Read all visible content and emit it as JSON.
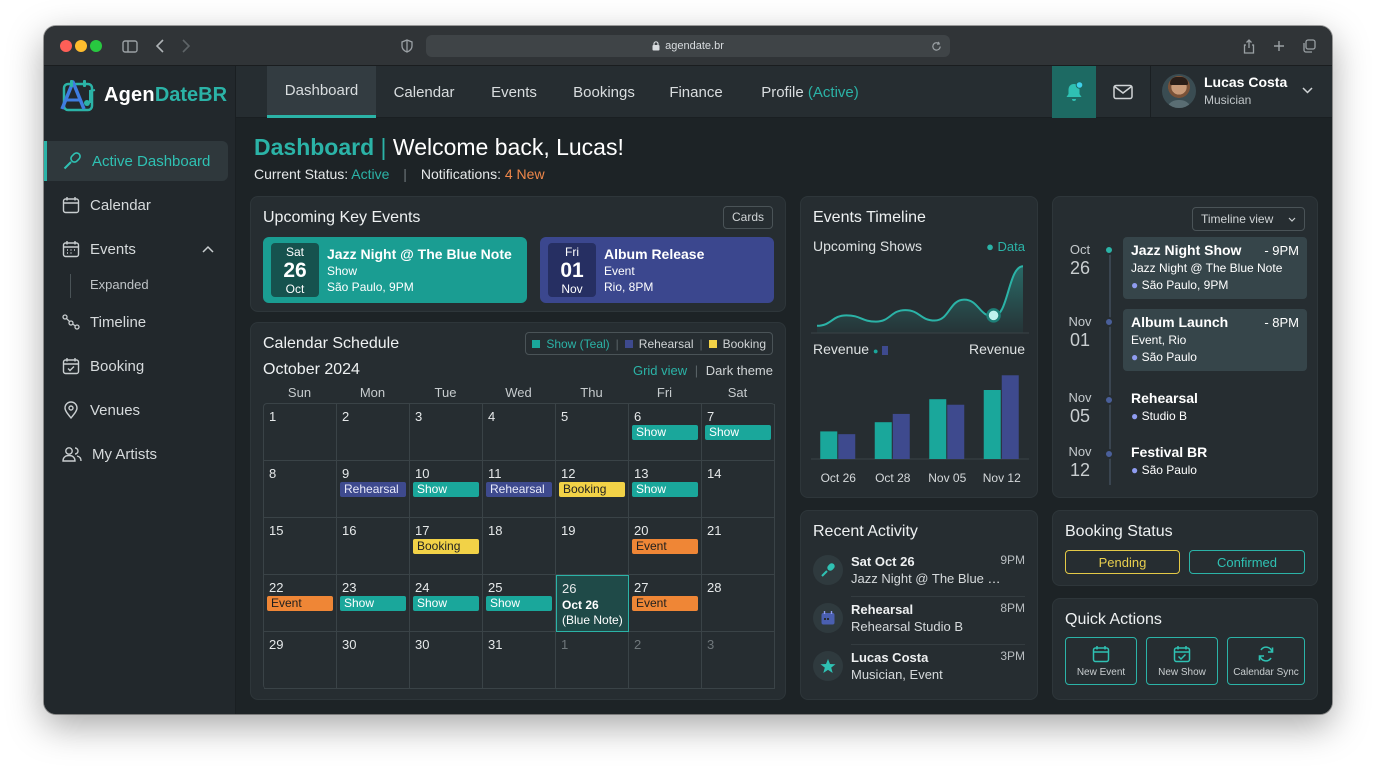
{
  "browser": {
    "url": "agendate.br"
  },
  "logo": {
    "part1": "Agen",
    "part2": "DateBR"
  },
  "sidebar": {
    "items": [
      {
        "label": "Active Dashboard",
        "icon": "microphone-icon"
      },
      {
        "label": "Calendar",
        "icon": "calendar-icon"
      },
      {
        "label": "Events",
        "icon": "calendar-grid-icon"
      },
      {
        "label": "Expanded"
      },
      {
        "label": "Timeline",
        "icon": "timeline-icon"
      },
      {
        "label": "Booking",
        "icon": "booking-icon"
      },
      {
        "label": "Venues",
        "icon": "location-pin-icon"
      },
      {
        "label": "My Artists",
        "icon": "users-icon"
      }
    ]
  },
  "nav": {
    "tabs": [
      "Dashboard",
      "Calendar",
      "Events",
      "Bookings",
      "Finance",
      "Profile"
    ],
    "profile_suffix": "(Active)"
  },
  "user": {
    "name": "Lucas Costa",
    "role": "Musician"
  },
  "header": {
    "title": "Dashboard",
    "sep": "|",
    "welcome": "Welcome back, Lucas!",
    "status_label": "Current Status:",
    "status_value": "Active",
    "notif_label": "Notifications:",
    "notif_value": "4 New"
  },
  "upcoming": {
    "title": "Upcoming Key Events",
    "toggle": "Cards",
    "events": [
      {
        "dow": "Sat",
        "day": "26",
        "mon": "Oct",
        "name": "Jazz Night @ The Blue Note",
        "type": "Show",
        "where": "São Paulo, 9PM"
      },
      {
        "dow": "Fri",
        "day": "01",
        "mon": "Nov",
        "name": "Album Release",
        "type": "Event",
        "where": "Rio, 8PM"
      }
    ]
  },
  "calendar": {
    "title": "Calendar Schedule",
    "month": "October 2024",
    "legend": [
      "Show (Teal)",
      "Rehearsal",
      "Booking"
    ],
    "grid_view": "Grid view",
    "dark_theme": "Dark theme",
    "days": [
      "Sun",
      "Mon",
      "Tue",
      "Wed",
      "Thu",
      "Fri",
      "Sat"
    ],
    "cells": [
      {
        "n": "1"
      },
      {
        "n": "2"
      },
      {
        "n": "3"
      },
      {
        "n": "4"
      },
      {
        "n": "5"
      },
      {
        "n": "6",
        "tag": "Show",
        "kind": "show"
      },
      {
        "n": "7",
        "tag": "Show",
        "kind": "show"
      },
      {
        "n": "8"
      },
      {
        "n": "9",
        "tag": "Rehearsal",
        "kind": "reh"
      },
      {
        "n": "10",
        "tag": "Show",
        "kind": "show"
      },
      {
        "n": "11",
        "tag": "Rehearsal",
        "kind": "reh"
      },
      {
        "n": "12",
        "tag": "Booking",
        "kind": "book"
      },
      {
        "n": "13",
        "tag": "Show",
        "kind": "show"
      },
      {
        "n": "14"
      },
      {
        "n": "15"
      },
      {
        "n": "16"
      },
      {
        "n": "17",
        "tag": "Booking",
        "kind": "book"
      },
      {
        "n": "18"
      },
      {
        "n": "19"
      },
      {
        "n": "20",
        "tag": "Event",
        "kind": "event"
      },
      {
        "n": "21"
      },
      {
        "n": "22",
        "tag": "Event",
        "kind": "event"
      },
      {
        "n": "23",
        "tag": "Show",
        "kind": "show"
      },
      {
        "n": "24",
        "tag": "Show",
        "kind": "show"
      },
      {
        "n": "25",
        "tag": "Show",
        "kind": "show"
      },
      {
        "n": "26",
        "highlight": "Oct 26",
        "note": "(Blue Note)"
      },
      {
        "n": "27",
        "tag": "Event",
        "kind": "event"
      },
      {
        "n": "28"
      },
      {
        "n": "29"
      },
      {
        "n": "30"
      },
      {
        "n": "30"
      },
      {
        "n": "31"
      },
      {
        "n": "1",
        "dim": true
      },
      {
        "n": "2",
        "dim": true
      },
      {
        "n": "3",
        "dim": true
      }
    ]
  },
  "timeline": {
    "title": "Events Timeline",
    "line_label": "Upcoming Shows",
    "data_label": "Data",
    "rev_label_left": "Revenue",
    "rev_label_right": "Revenue"
  },
  "chart_data": [
    {
      "type": "area",
      "values": [
        5,
        15,
        9,
        20,
        10,
        30,
        14,
        62
      ],
      "highlight_index": 6
    },
    {
      "type": "bar",
      "categories": [
        "Oct 26",
        "Oct 28",
        "Nov 05",
        "Nov 12"
      ],
      "series": [
        {
          "values": [
            30,
            40,
            65,
            75
          ]
        },
        {
          "values": [
            27,
            49,
            59,
            91
          ]
        }
      ],
      "ylim": [
        0,
        100
      ]
    }
  ],
  "timeline_view": {
    "select": "Timeline view",
    "items": [
      {
        "mon": "Oct",
        "day": "26",
        "title": "Jazz Night Show",
        "time": "- 9PM",
        "sub": "Jazz Night @ The Blue Note",
        "loc": "São Paulo, 9PM",
        "boxed": true
      },
      {
        "mon": "Nov",
        "day": "01",
        "title": "Album Launch",
        "time": "- 8PM",
        "sub": "Event, Rio",
        "loc": "São Paulo",
        "boxed": true
      },
      {
        "mon": "Nov",
        "day": "05",
        "title": "Rehearsal",
        "loc": "Studio B"
      },
      {
        "mon": "Nov",
        "day": "12",
        "title": "Festival BR",
        "loc": "São Paulo"
      }
    ]
  },
  "activity": {
    "title": "Recent Activity",
    "items": [
      {
        "title": "Sat Oct 26",
        "sub": "Jazz Night @ The Blue Note",
        "time": "9PM",
        "icon": "microphone-icon"
      },
      {
        "title": "Rehearsal",
        "sub": "Rehearsal Studio B",
        "time": "8PM",
        "icon": "calendar-icon"
      },
      {
        "title": "Lucas Costa",
        "sub": "Musician, Event",
        "time": "3PM",
        "icon": "star-icon"
      }
    ]
  },
  "booking": {
    "title": "Booking Status",
    "pending": "Pending",
    "confirmed": "Confirmed"
  },
  "quick": {
    "title": "Quick Actions",
    "actions": [
      "New Event",
      "New Show",
      "Calendar Sync"
    ]
  },
  "colors": {
    "teal": "#2bb3a7",
    "indigo": "#3e4a8e",
    "yellow": "#f2d247",
    "orange": "#ef8636",
    "bg": "#1d2326",
    "card": "#262d31"
  }
}
